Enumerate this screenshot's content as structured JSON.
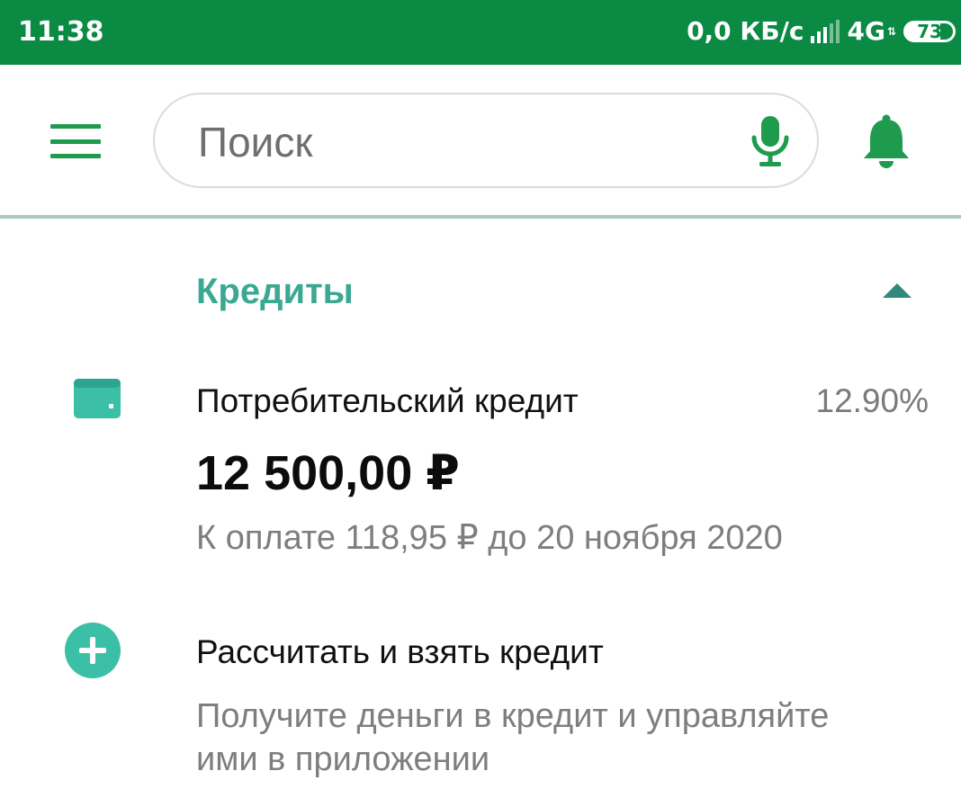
{
  "status_bar": {
    "time": "11:38",
    "speed": "0,0 КБ/с",
    "network": "4G",
    "battery": "73"
  },
  "search": {
    "placeholder": "Поиск"
  },
  "credits": {
    "title": "Кредиты",
    "loan": {
      "name": "Потребительский кредит",
      "rate": "12.90%",
      "amount": "12 500,00 ₽",
      "payment": "К оплате 118,95 ₽ до 20 ноября 2020"
    },
    "new_loan": {
      "title": "Рассчитать и взять кредит",
      "description": "Получите деньги в кредит и управляйте ими в приложении"
    }
  },
  "icons": {
    "menu": "menu-icon",
    "mic": "microphone-icon",
    "bell": "bell-icon",
    "collapse": "chevron-up-icon",
    "wallet": "wallet-icon",
    "plus": "plus-icon"
  },
  "colors": {
    "status_bar": "#0b8a43",
    "primary_green": "#1f9b4d",
    "teal_accent": "#3aa892"
  }
}
